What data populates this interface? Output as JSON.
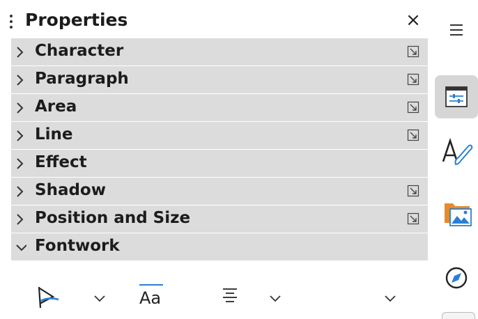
{
  "panel": {
    "title": "Properties",
    "close_glyph": "×"
  },
  "sections": [
    {
      "label": "Character",
      "expanded": false,
      "has_more_options": true
    },
    {
      "label": "Paragraph",
      "expanded": false,
      "has_more_options": true
    },
    {
      "label": "Area",
      "expanded": false,
      "has_more_options": true
    },
    {
      "label": "Line",
      "expanded": false,
      "has_more_options": true
    },
    {
      "label": "Effect",
      "expanded": false,
      "has_more_options": false
    },
    {
      "label": "Shadow",
      "expanded": false,
      "has_more_options": true
    },
    {
      "label": "Position and Size",
      "expanded": false,
      "has_more_options": true
    },
    {
      "label": "Fontwork",
      "expanded": true,
      "has_more_options": false
    }
  ],
  "fontwork_toolbar": {
    "shape_icon": "fontwork-shape-icon",
    "same_letter_heights_glyph": "Aa",
    "alignment_icon": "align-center-icon",
    "spacing_icon": "chevron-down-icon"
  },
  "deck": {
    "menu_icon": "hamburger-icon",
    "buttons": [
      {
        "icon": "properties-icon",
        "active": true
      },
      {
        "icon": "styles-icon",
        "active": false
      },
      {
        "icon": "gallery-icon",
        "active": false
      },
      {
        "icon": "navigator-icon",
        "active": false
      }
    ]
  },
  "colors": {
    "section_bg": "#dcdcdc",
    "deck_active_bg": "#d6d6d6",
    "accent_blue": "#2a7fd4",
    "folder_orange": "#e8892c"
  }
}
